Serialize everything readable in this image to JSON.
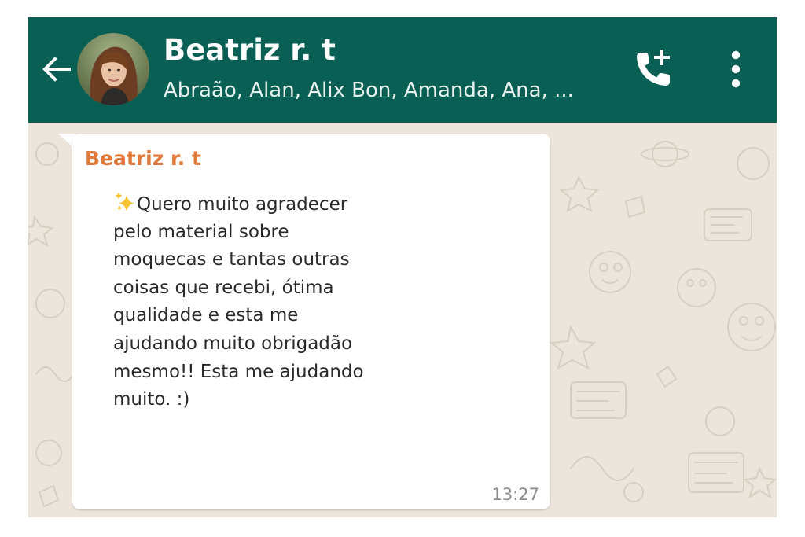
{
  "header": {
    "title": "Beatriz r. t",
    "subtitle": "Abraão, Alan, Alix Bon, Amanda, Ana, ...",
    "back_icon": "arrow-left-icon",
    "call_icon": "add-call-icon",
    "menu_icon": "more-vertical-icon",
    "background_color": "#0a5f54"
  },
  "message": {
    "sender": "Beatriz r. t",
    "sender_color": "#e0783a",
    "emoji": "sparkles",
    "lines": [
      "Quero muito agradecer",
      "pelo material sobre",
      "moquecas e tantas outras",
      "coisas que recebi, ótima",
      "qualidade e esta me",
      "ajudando muito obrigadão",
      "mesmo!! Esta me ajudando",
      "muito. :)"
    ],
    "time": "13:27"
  },
  "chat": {
    "wallpaper_color": "#ece5dc"
  }
}
